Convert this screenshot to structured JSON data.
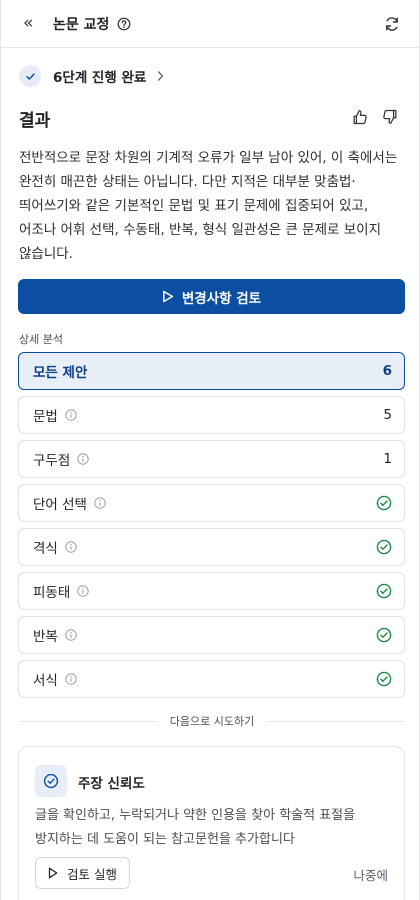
{
  "header": {
    "title": "논문 교정",
    "collapse_glyph": "«"
  },
  "step": {
    "label": "6단계 진행 완료"
  },
  "result": {
    "title": "결과",
    "body": "전반적으로 문장 차원의 기계적 오류가 일부 남아 있어, 이 축에서는 완전히 매끈한 상태는 아닙니다. 다만 지적은 대부분 맞춤법·띄어쓰기와 같은 기본적인 문법 및 표기 문제에 집중되어 있고, 어조나 어휘 선택, 수동태, 반복, 형식 일관성은 큰 문제로 보이지 않습니다."
  },
  "review_button": {
    "label": "변경사항 검토"
  },
  "analysis": {
    "section_label": "상세 분석",
    "categories": [
      {
        "name": "모든 제안",
        "count": "6",
        "active": true,
        "info": false
      },
      {
        "name": "문법",
        "count": "5",
        "info": true
      },
      {
        "name": "구두점",
        "count": "1",
        "info": true
      },
      {
        "name": "단어 선택",
        "count": null,
        "info": true
      },
      {
        "name": "격식",
        "count": null,
        "info": true
      },
      {
        "name": "피동태",
        "count": null,
        "info": true
      },
      {
        "name": "반복",
        "count": null,
        "info": true
      },
      {
        "name": "서식",
        "count": null,
        "info": true
      }
    ]
  },
  "next": {
    "divider_label": "다음으로 시도하기"
  },
  "card": {
    "title": "주장 신뢰도",
    "description": "글을 확인하고, 누락되거나 약한 인용을 찾아 학술적 표절을 방지하는 데 도움이 되는 참고문헌을 추가합니다",
    "run_label": "검토 실행",
    "later_label": "나중에"
  },
  "colors": {
    "primary": "#0b4ea2",
    "active_bg": "#e8eff9",
    "success": "#1f8a43",
    "border": "#dfe2e6"
  },
  "icons": {
    "collapse": "double-chevron-left-icon",
    "help": "question-circle-icon",
    "refresh": "refresh-icon",
    "step_check": "check-icon",
    "step_chevron": "chevron-right-icon",
    "thumbs_up": "thumbs-up-icon",
    "thumbs_down": "thumbs-down-icon",
    "play": "play-icon",
    "info": "info-circle-icon",
    "ok": "check-circle-icon",
    "card": "shield-check-icon"
  }
}
